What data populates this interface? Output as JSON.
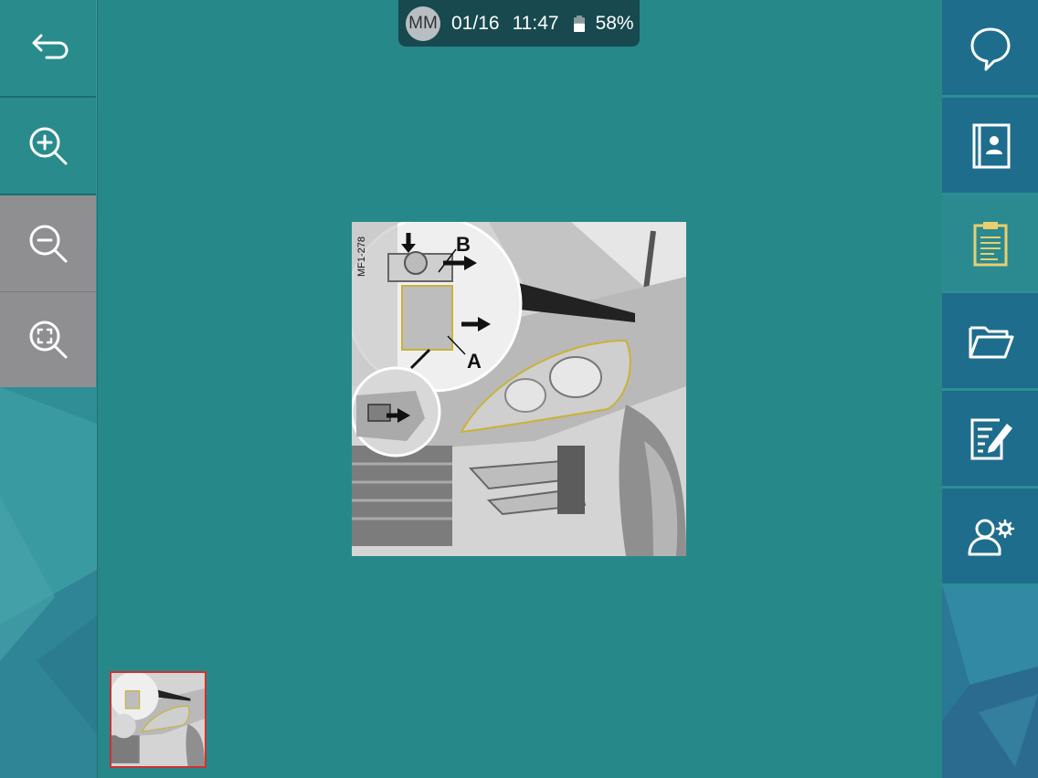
{
  "status_bar": {
    "user_initials": "MM",
    "date": "01/16",
    "time": "11:47",
    "battery": "58%",
    "battery_level": 0.58
  },
  "left_toolbar": {
    "buttons": [
      {
        "name": "back",
        "icon": "back-arrow-icon"
      },
      {
        "name": "zoom-in",
        "icon": "zoom-in-icon"
      },
      {
        "name": "zoom-out",
        "icon": "zoom-out-icon"
      },
      {
        "name": "zoom-fit",
        "icon": "zoom-fit-icon"
      }
    ]
  },
  "right_toolbar": {
    "buttons": [
      {
        "name": "chat",
        "icon": "speech-bubble-icon"
      },
      {
        "name": "contacts",
        "icon": "contact-book-icon"
      },
      {
        "name": "clipboard",
        "icon": "clipboard-icon",
        "active": true
      },
      {
        "name": "folder",
        "icon": "folder-icon"
      },
      {
        "name": "edit-notes",
        "icon": "edit-note-icon"
      },
      {
        "name": "user-settings",
        "icon": "user-settings-icon"
      }
    ]
  },
  "figure": {
    "code": "MF1-278",
    "label_a": "A",
    "label_b": "B"
  },
  "colors": {
    "background": "#27888a",
    "active_accent": "#e8cf6f",
    "thumbnail_border": "#d03030"
  }
}
